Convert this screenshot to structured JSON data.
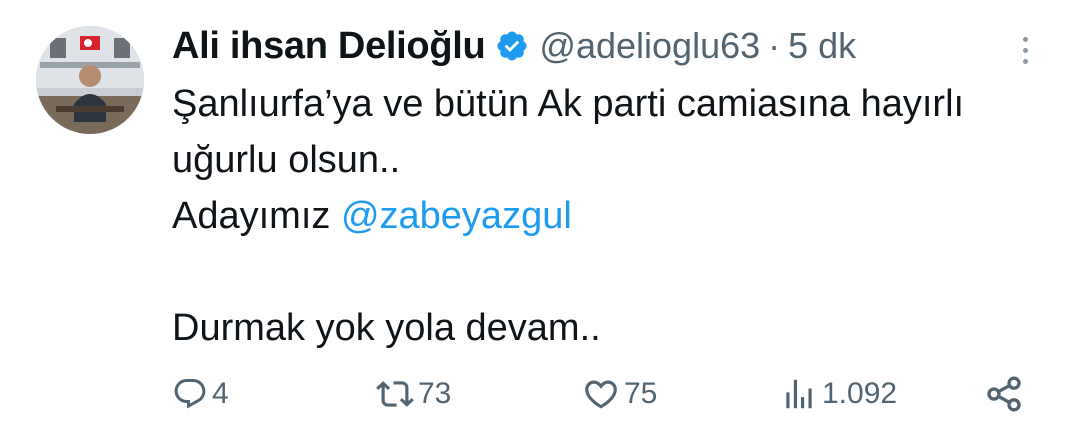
{
  "author": {
    "name": "Ali ihsan Delioğlu",
    "handle": "@adelioglu63",
    "separator": "·",
    "time": "5 dk",
    "verified_icon": "verified-badge-icon",
    "avatar_icon": "profile-photo"
  },
  "tweet": {
    "line1": "Şanlıurfa’ya ve bütün Ak parti camiasına hayırlı",
    "line2": "uğurlu olsun..",
    "line3_prefix": "Adayımız ",
    "line3_mention": "@zabeyazgul",
    "line5": "Durmak yok yola devam.."
  },
  "actions": {
    "reply": {
      "icon": "reply-icon",
      "count": "4"
    },
    "retweet": {
      "icon": "retweet-icon",
      "count": "73"
    },
    "like": {
      "icon": "heart-icon",
      "count": "75"
    },
    "views": {
      "icon": "views-icon",
      "count": "1.092"
    },
    "share": {
      "icon": "share-icon"
    }
  },
  "colors": {
    "text": "#0f1419",
    "secondary": "#536471",
    "link": "#1d9bf0",
    "verified": "#1d9bf0"
  }
}
